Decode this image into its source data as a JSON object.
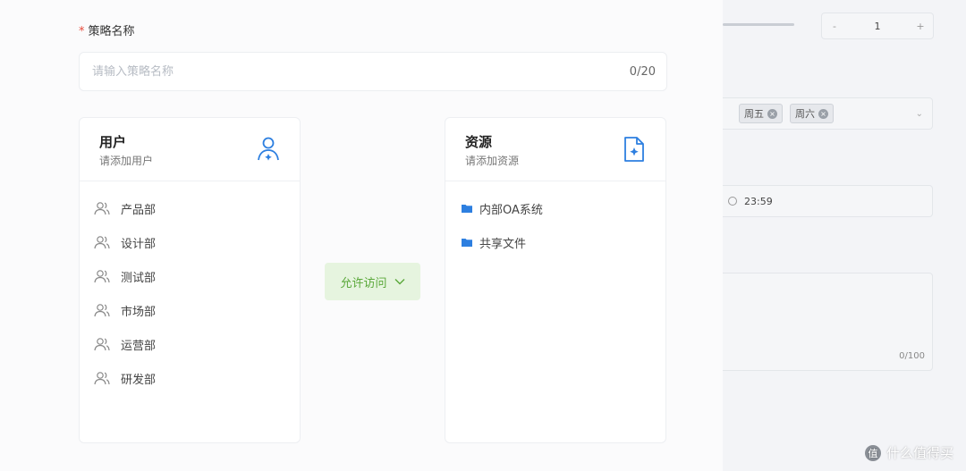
{
  "form": {
    "required_mark": "*",
    "name_label": "策略名称",
    "name_placeholder": "请输入策略名称",
    "name_value": "",
    "name_count": "0/20"
  },
  "users_card": {
    "title": "用户",
    "subtitle": "请添加用户",
    "icon": "user-add-icon",
    "items": [
      {
        "label": "产品部",
        "icon": "people-icon"
      },
      {
        "label": "设计部",
        "icon": "people-icon"
      },
      {
        "label": "测试部",
        "icon": "people-icon"
      },
      {
        "label": "市场部",
        "icon": "people-icon"
      },
      {
        "label": "运营部",
        "icon": "people-icon"
      },
      {
        "label": "研发部",
        "icon": "people-icon"
      }
    ]
  },
  "resources_card": {
    "title": "资源",
    "subtitle": "请添加资源",
    "icon": "file-add-icon",
    "items": [
      {
        "label": "内部OA系统",
        "icon": "folder-icon"
      },
      {
        "label": "共享文件",
        "icon": "folder-icon"
      }
    ]
  },
  "access": {
    "label": "允许访问",
    "icon": "chevron-down-icon"
  },
  "background": {
    "stepper_value": "1",
    "stepper_minus": "-",
    "stepper_plus": "+",
    "tags": [
      "周五",
      "周六"
    ],
    "time_value": "23:59",
    "textarea_count": "0/100"
  },
  "watermark": {
    "text": "什么值得买",
    "logo": "值"
  },
  "colors": {
    "accent_blue": "#2d7fe0",
    "accent_green": "#5aa83a",
    "required_red": "#e74c3c"
  }
}
